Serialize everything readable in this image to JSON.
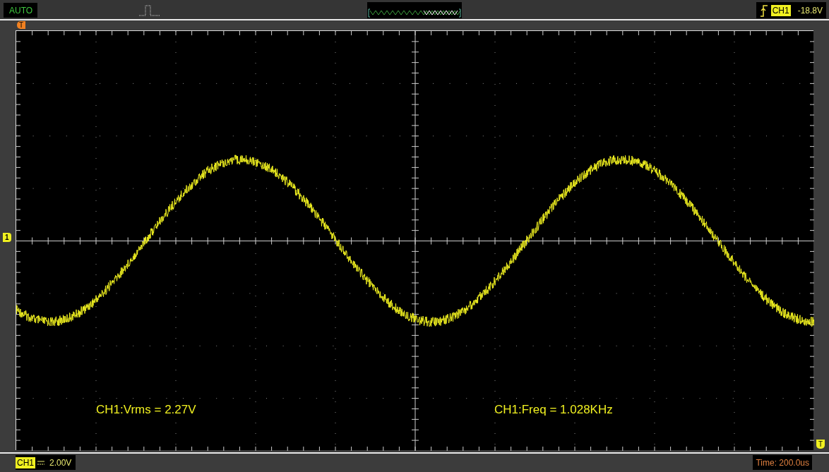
{
  "trigger_mode": "AUTO",
  "trigger": {
    "channel": "CH1",
    "level": "-18.8V"
  },
  "markers": {
    "trigger_position": "T",
    "channel_level": "1",
    "trigger_level": "T"
  },
  "measurements": [
    {
      "text": "CH1:Vrms = 2.27V"
    },
    {
      "text": "CH1:Freq = 1.028KHz"
    }
  ],
  "channel_status": {
    "channel": "CH1",
    "scale": "2.00V"
  },
  "timebase": "Time: 200.0us"
}
